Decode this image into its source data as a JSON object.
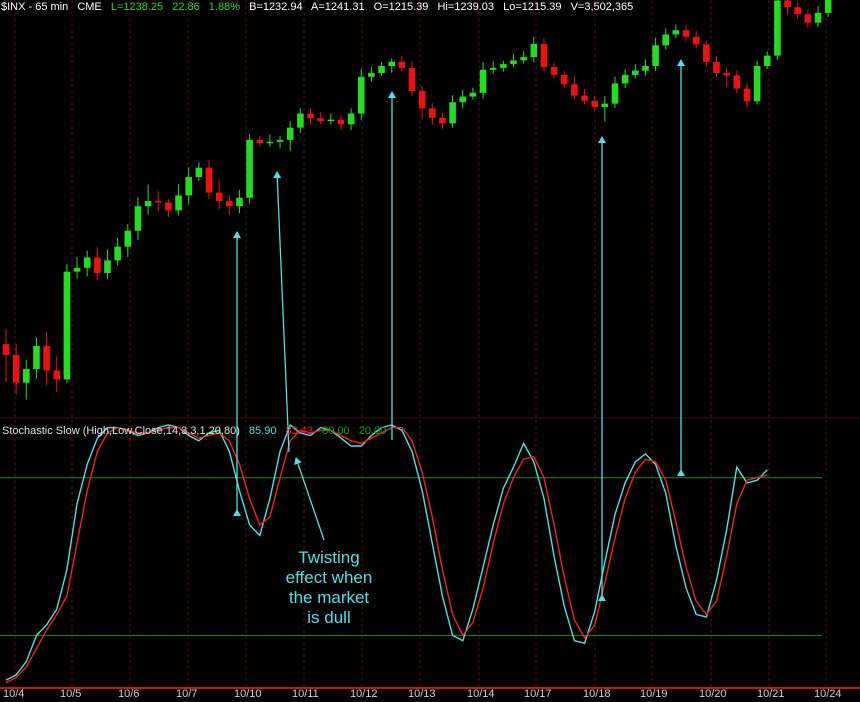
{
  "header": {
    "symbol": "$INX - 65 min",
    "exchange": "CME",
    "last": "L=1238.25",
    "change": "22.86",
    "pct": "1.88%",
    "bid": "B=1232.94",
    "ask": "A=1241.31",
    "open": "O=1215.39",
    "high": "Hi=1239.03",
    "low": "Lo=1215.39",
    "volume": "V=3,502,365"
  },
  "stochastic": {
    "label": "Stochastic Slow (High,Low,Close,14,3,3,1,20,80)",
    "k_value": "85.90",
    "d_value": "83.43",
    "upper": "80.00",
    "lower": "20.00"
  },
  "annotation": "Twisting\neffect when\nthe market\nis dull",
  "colors": {
    "up": "#22dd22",
    "down": "#ee1111",
    "k_line": "#4fe0e6",
    "d_line": "#ee2222",
    "level": "#1a8a1a",
    "grid": "#5a1414"
  },
  "chart_data": [
    {
      "type": "candlestick",
      "title": "$INX - 65 min",
      "x": [
        "10/4",
        "10/5",
        "10/6",
        "10/7",
        "10/10",
        "10/11",
        "10/12",
        "10/13",
        "10/14",
        "10/17",
        "10/18",
        "10/19",
        "10/20",
        "10/21",
        "10/24"
      ],
      "ylim": [
        1160,
        1245
      ],
      "candles": [
        {
          "o": 1174.0,
          "c": 1171.7,
          "h": 1177.2,
          "l": 1166.0
        },
        {
          "o": 1171.7,
          "c": 1165.8,
          "h": 1174.0,
          "l": 1163.3
        },
        {
          "o": 1165.8,
          "c": 1168.7,
          "h": 1170.7,
          "l": 1162.2
        },
        {
          "o": 1168.7,
          "c": 1173.6,
          "h": 1175.5,
          "l": 1166.7
        },
        {
          "o": 1173.6,
          "c": 1168.4,
          "h": 1176.6,
          "l": 1165.2
        },
        {
          "o": 1168.4,
          "c": 1166.5,
          "h": 1171.4,
          "l": 1163.8
        },
        {
          "o": 1166.5,
          "c": 1189.4,
          "h": 1191.0,
          "l": 1165.8
        },
        {
          "o": 1189.4,
          "c": 1190.2,
          "h": 1192.5,
          "l": 1187.9
        },
        {
          "o": 1190.2,
          "c": 1192.4,
          "h": 1193.9,
          "l": 1188.4
        },
        {
          "o": 1192.4,
          "c": 1189.1,
          "h": 1194.6,
          "l": 1187.5
        },
        {
          "o": 1189.1,
          "c": 1191.8,
          "h": 1194.1,
          "l": 1187.8
        },
        {
          "o": 1191.8,
          "c": 1194.7,
          "h": 1196.6,
          "l": 1190.7
        },
        {
          "o": 1194.7,
          "c": 1198.1,
          "h": 1199.5,
          "l": 1192.5
        },
        {
          "o": 1198.1,
          "c": 1203.3,
          "h": 1205.2,
          "l": 1196.1
        },
        {
          "o": 1203.3,
          "c": 1204.4,
          "h": 1207.9,
          "l": 1201.5
        },
        {
          "o": 1204.4,
          "c": 1204.1,
          "h": 1206.6,
          "l": 1202.2
        },
        {
          "o": 1204.1,
          "c": 1202.4,
          "h": 1204.8,
          "l": 1201.0
        },
        {
          "o": 1202.4,
          "c": 1205.6,
          "h": 1208.0,
          "l": 1201.3
        },
        {
          "o": 1205.6,
          "c": 1209.5,
          "h": 1211.6,
          "l": 1203.7
        },
        {
          "o": 1209.5,
          "c": 1211.5,
          "h": 1212.6,
          "l": 1208.7
        },
        {
          "o": 1211.5,
          "c": 1206.2,
          "h": 1213.1,
          "l": 1204.8
        },
        {
          "o": 1206.2,
          "c": 1204.4,
          "h": 1208.8,
          "l": 1202.6
        },
        {
          "o": 1204.4,
          "c": 1203.3,
          "h": 1205.6,
          "l": 1201.5
        },
        {
          "o": 1203.3,
          "c": 1205.1,
          "h": 1206.8,
          "l": 1201.8
        },
        {
          "o": 1205.1,
          "c": 1217.4,
          "h": 1218.6,
          "l": 1203.9
        },
        {
          "o": 1217.4,
          "c": 1216.7,
          "h": 1218.3,
          "l": 1216.0
        },
        {
          "o": 1216.7,
          "c": 1217.0,
          "h": 1218.6,
          "l": 1215.9
        },
        {
          "o": 1217.0,
          "c": 1217.4,
          "h": 1218.2,
          "l": 1215.6
        },
        {
          "o": 1217.4,
          "c": 1220.0,
          "h": 1221.4,
          "l": 1215.0
        },
        {
          "o": 1220.0,
          "c": 1223.0,
          "h": 1224.1,
          "l": 1218.9
        },
        {
          "o": 1223.0,
          "c": 1222.0,
          "h": 1224.1,
          "l": 1220.7
        },
        {
          "o": 1222.0,
          "c": 1221.4,
          "h": 1223.3,
          "l": 1220.7
        },
        {
          "o": 1221.4,
          "c": 1221.7,
          "h": 1223.0,
          "l": 1220.7
        },
        {
          "o": 1221.7,
          "c": 1220.7,
          "h": 1222.6,
          "l": 1219.5
        },
        {
          "o": 1220.7,
          "c": 1223.0,
          "h": 1224.1,
          "l": 1219.5
        },
        {
          "o": 1223.0,
          "c": 1230.8,
          "h": 1232.5,
          "l": 1221.6
        },
        {
          "o": 1230.8,
          "c": 1231.6,
          "h": 1232.9,
          "l": 1229.8
        },
        {
          "o": 1231.6,
          "c": 1233.1,
          "h": 1234.0,
          "l": 1231.0
        },
        {
          "o": 1233.1,
          "c": 1234.0,
          "h": 1234.7,
          "l": 1231.7
        },
        {
          "o": 1234.0,
          "c": 1232.7,
          "h": 1235.3,
          "l": 1231.9
        },
        {
          "o": 1232.7,
          "c": 1227.8,
          "h": 1234.1,
          "l": 1226.8
        },
        {
          "o": 1227.8,
          "c": 1224.1,
          "h": 1228.8,
          "l": 1221.8
        },
        {
          "o": 1224.1,
          "c": 1222.1,
          "h": 1225.2,
          "l": 1220.6
        },
        {
          "o": 1222.1,
          "c": 1220.9,
          "h": 1223.2,
          "l": 1219.8
        },
        {
          "o": 1220.9,
          "c": 1225.4,
          "h": 1226.9,
          "l": 1220.0
        },
        {
          "o": 1225.4,
          "c": 1226.6,
          "h": 1228.0,
          "l": 1224.1
        },
        {
          "o": 1226.6,
          "c": 1227.4,
          "h": 1228.5,
          "l": 1226.0
        },
        {
          "o": 1227.4,
          "c": 1232.3,
          "h": 1234.0,
          "l": 1226.1
        },
        {
          "o": 1232.3,
          "c": 1232.7,
          "h": 1234.1,
          "l": 1231.4
        },
        {
          "o": 1232.7,
          "c": 1233.5,
          "h": 1234.2,
          "l": 1231.9
        },
        {
          "o": 1233.5,
          "c": 1234.3,
          "h": 1235.6,
          "l": 1232.9
        },
        {
          "o": 1234.3,
          "c": 1235.0,
          "h": 1236.3,
          "l": 1233.6
        },
        {
          "o": 1235.0,
          "c": 1237.8,
          "h": 1239.3,
          "l": 1233.9
        },
        {
          "o": 1237.8,
          "c": 1232.9,
          "h": 1239.0,
          "l": 1232.0
        },
        {
          "o": 1232.9,
          "c": 1231.2,
          "h": 1233.8,
          "l": 1230.4
        },
        {
          "o": 1231.2,
          "c": 1229.2,
          "h": 1232.1,
          "l": 1228.3
        },
        {
          "o": 1229.2,
          "c": 1226.8,
          "h": 1231.1,
          "l": 1225.9
        },
        {
          "o": 1226.8,
          "c": 1225.7,
          "h": 1228.2,
          "l": 1224.9
        },
        {
          "o": 1225.7,
          "c": 1224.4,
          "h": 1226.7,
          "l": 1223.5
        },
        {
          "o": 1224.4,
          "c": 1225.1,
          "h": 1226.7,
          "l": 1221.3
        },
        {
          "o": 1225.1,
          "c": 1229.4,
          "h": 1230.8,
          "l": 1224.2
        },
        {
          "o": 1229.4,
          "c": 1231.2,
          "h": 1232.4,
          "l": 1228.4
        },
        {
          "o": 1231.2,
          "c": 1232.1,
          "h": 1233.5,
          "l": 1230.4
        },
        {
          "o": 1232.1,
          "c": 1233.1,
          "h": 1234.5,
          "l": 1231.0
        },
        {
          "o": 1233.1,
          "c": 1237.5,
          "h": 1239.1,
          "l": 1232.0
        },
        {
          "o": 1237.5,
          "c": 1239.8,
          "h": 1241.1,
          "l": 1236.6
        },
        {
          "o": 1239.8,
          "c": 1240.7,
          "h": 1241.9,
          "l": 1239.0
        },
        {
          "o": 1240.7,
          "c": 1239.3,
          "h": 1241.8,
          "l": 1238.3
        },
        {
          "o": 1239.3,
          "c": 1237.7,
          "h": 1240.5,
          "l": 1236.8
        },
        {
          "o": 1237.7,
          "c": 1234.0,
          "h": 1238.5,
          "l": 1233.0
        },
        {
          "o": 1234.0,
          "c": 1231.6,
          "h": 1235.2,
          "l": 1230.8
        },
        {
          "o": 1231.6,
          "c": 1231.1,
          "h": 1232.8,
          "l": 1228.6
        },
        {
          "o": 1231.1,
          "c": 1228.3,
          "h": 1232.2,
          "l": 1227.3
        },
        {
          "o": 1228.3,
          "c": 1225.6,
          "h": 1229.4,
          "l": 1224.3
        },
        {
          "o": 1225.6,
          "c": 1233.1,
          "h": 1234.2,
          "l": 1224.9
        },
        {
          "o": 1233.1,
          "c": 1235.3,
          "h": 1236.2,
          "l": 1232.5
        },
        {
          "o": 1235.3,
          "c": 1247.0,
          "h": 1248.0,
          "l": 1234.4
        },
        {
          "o": 1247.0,
          "c": 1245.6,
          "h": 1247.4,
          "l": 1244.0
        },
        {
          "o": 1245.6,
          "c": 1244.1,
          "h": 1246.8,
          "l": 1243.1
        },
        {
          "o": 1244.1,
          "c": 1242.3,
          "h": 1245.2,
          "l": 1241.2
        },
        {
          "o": 1242.3,
          "c": 1244.4,
          "h": 1245.8,
          "l": 1241.4
        },
        {
          "o": 1244.4,
          "c": 1247.4,
          "h": 1248.5,
          "l": 1243.5
        }
      ]
    },
    {
      "type": "line",
      "title": "Stochastic Slow (High,Low,Close,14,3,3,1,20,80)",
      "ylim": [
        0,
        100
      ],
      "levels": [
        80,
        20
      ],
      "series": [
        {
          "name": "85.90",
          "values": [
            3,
            5,
            10,
            20,
            24,
            30,
            45,
            70,
            85,
            95,
            99,
            99,
            98,
            96,
            97,
            99,
            100,
            99,
            96,
            94,
            97,
            98,
            90,
            75,
            62,
            58,
            72,
            90,
            100,
            97,
            96,
            99,
            98,
            95,
            92,
            92,
            96,
            99,
            100,
            98,
            90,
            75,
            55,
            35,
            20,
            18,
            30,
            46,
            62,
            76,
            84,
            93,
            86,
            72,
            50,
            31,
            18,
            17,
            29,
            48,
            66,
            78,
            86,
            89,
            85,
            74,
            54,
            38,
            28,
            27,
            41,
            60,
            84,
            78,
            79,
            83
          ]
        },
        {
          "name": "83.43",
          "values": [
            2,
            4,
            8,
            15,
            22,
            28,
            35,
            55,
            75,
            90,
            97,
            99,
            98,
            97,
            97,
            98,
            99,
            99,
            97,
            95,
            96,
            97,
            94,
            85,
            72,
            62,
            65,
            80,
            94,
            98,
            97,
            98,
            98,
            96,
            94,
            93,
            95,
            97,
            99,
            99,
            94,
            82,
            65,
            45,
            28,
            20,
            25,
            38,
            55,
            70,
            80,
            87,
            88,
            80,
            62,
            42,
            26,
            19,
            24,
            40,
            57,
            72,
            82,
            87,
            86,
            79,
            63,
            46,
            33,
            28,
            33,
            50,
            70,
            79,
            80,
            81
          ]
        }
      ]
    }
  ]
}
